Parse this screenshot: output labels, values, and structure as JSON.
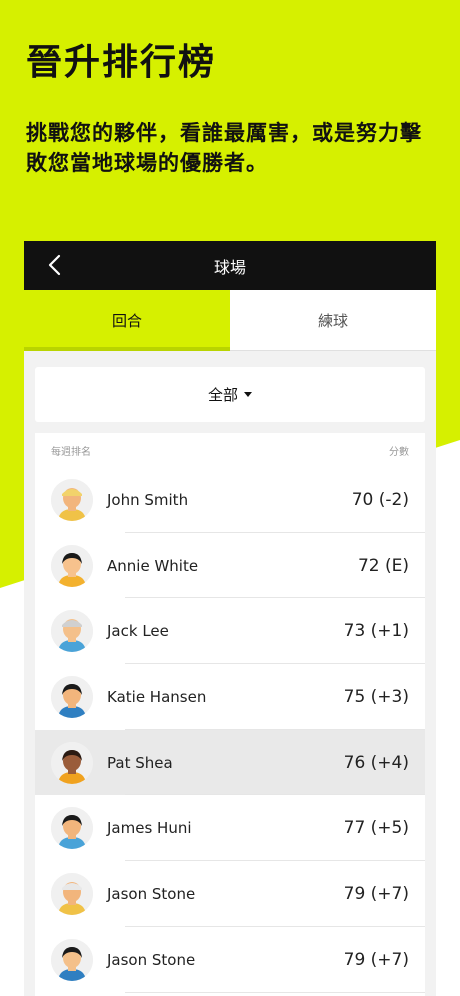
{
  "hero": {
    "title": "晉升排行榜",
    "subtitle_line1": "挑戰您的夥伴，看誰最厲害，或是努力擊",
    "subtitle_line2": "敗您當地球場的優勝者。"
  },
  "topbar": {
    "title": "球場",
    "back_icon": "chevron-left-icon"
  },
  "tabs": [
    {
      "label": "回合",
      "active": true
    },
    {
      "label": "練球",
      "active": false
    }
  ],
  "filter": {
    "label": "全部",
    "icon": "caret-down-icon"
  },
  "board": {
    "rank_header": "每週排名",
    "score_header": "分數",
    "rows": [
      {
        "name": "John Smith",
        "score": "70 (-2)",
        "avatar": {
          "hair": "#f2d36b",
          "skin": "#f2b57c",
          "shirt": "#f0c247",
          "cap": true
        }
      },
      {
        "name": "Annie White",
        "score": "72 (E)",
        "avatar": {
          "hair": "#1a1a1a",
          "skin": "#f7c28d",
          "shirt": "#f3b12e",
          "cap": false
        }
      },
      {
        "name": "Jack Lee",
        "score": "73 (+1)",
        "avatar": {
          "hair": "#d0d0d0",
          "skin": "#f4c08a",
          "shirt": "#4aa3d8",
          "cap": true
        }
      },
      {
        "name": "Katie Hansen",
        "score": "75 (+3)",
        "avatar": {
          "hair": "#1a1a1a",
          "skin": "#f2b57c",
          "shirt": "#2f7fc1",
          "cap": false
        }
      },
      {
        "name": "Pat Shea",
        "score": "76 (+4)",
        "avatar": {
          "hair": "#2a1a12",
          "skin": "#9a5c3a",
          "shirt": "#f0a21f",
          "cap": false
        }
      },
      {
        "name": "James Huni",
        "score": "77 (+5)",
        "avatar": {
          "hair": "#1a1a1a",
          "skin": "#f2b57c",
          "shirt": "#4aa3d8",
          "cap": false
        }
      },
      {
        "name": "Jason Stone",
        "score": "79 (+7)",
        "avatar": {
          "hair": "#e8e8e8",
          "skin": "#f2b57c",
          "shirt": "#f0c247",
          "cap": true
        }
      },
      {
        "name": "Jason Stone",
        "score": "79 (+7)",
        "avatar": {
          "hair": "#1a1a1a",
          "skin": "#f4c08a",
          "shirt": "#2f7fc1",
          "cap": false
        }
      }
    ],
    "highlighted_index": 4
  },
  "colors": {
    "accent": "#d6f000",
    "dark": "#111111"
  }
}
